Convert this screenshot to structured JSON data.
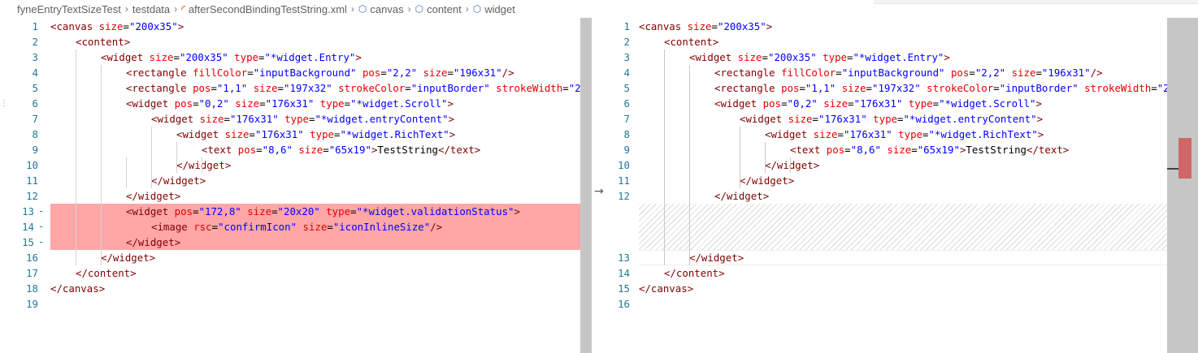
{
  "breadcrumb": {
    "items": [
      "fyneEntryTextSizeTest",
      "testdata",
      "afterSecondBindingTestString.xml",
      "canvas",
      "content",
      "widget"
    ],
    "separator": ">"
  },
  "icons": {
    "rss": "rss-icon",
    "xml_node": "cube-icon",
    "compare_arrow": "arrow-right-icon"
  },
  "colors": {
    "removed_highlight": "#ffa6a6",
    "line_number": "#237893",
    "tag": "#800000",
    "attribute": "#e50000",
    "value": "#0000ff"
  },
  "left_lines": [
    {
      "num": "1",
      "code": "<canvas size=\"200x35\">"
    },
    {
      "num": "2",
      "code": "<content>"
    },
    {
      "num": "3",
      "code": "<widget size=\"200x35\" type=\"*widget.Entry\">"
    },
    {
      "num": "4",
      "code": "<rectangle fillColor=\"inputBackground\" pos=\"2,2\" size=\"196x31\"/>"
    },
    {
      "num": "5",
      "code": "<rectangle pos=\"1,1\" size=\"197x32\" strokeColor=\"inputBorder\" strokeWidth=\"2"
    },
    {
      "num": "6",
      "code": "<widget pos=\"0,2\" size=\"176x31\" type=\"*widget.Scroll\">"
    },
    {
      "num": "7",
      "code": "<widget size=\"176x31\" type=\"*widget.entryContent\">"
    },
    {
      "num": "8",
      "code": "<widget size=\"176x31\" type=\"*widget.RichText\">"
    },
    {
      "num": "9",
      "code": "<text pos=\"8,6\" size=\"65x19\">TestString</text>"
    },
    {
      "num": "10",
      "code": "</widget>"
    },
    {
      "num": "11",
      "code": "</widget>"
    },
    {
      "num": "12",
      "code": "</widget>"
    },
    {
      "num": "13",
      "code": "<widget pos=\"172,8\" size=\"20x20\" type=\"*widget.validationStatus\">",
      "removed": true
    },
    {
      "num": "14",
      "code": "<image rsc=\"confirmIcon\" size=\"iconInlineSize\"/>",
      "removed": true
    },
    {
      "num": "15",
      "code": "</widget>",
      "removed": true
    },
    {
      "num": "16",
      "code": "</widget>"
    },
    {
      "num": "17",
      "code": "</content>"
    },
    {
      "num": "18",
      "code": "</canvas>"
    },
    {
      "num": "19",
      "code": ""
    }
  ],
  "right_lines": [
    {
      "num": "1",
      "code": "<canvas size=\"200x35\">"
    },
    {
      "num": "2",
      "code": "<content>"
    },
    {
      "num": "3",
      "code": "<widget size=\"200x35\" type=\"*widget.Entry\">"
    },
    {
      "num": "4",
      "code": "<rectangle fillColor=\"inputBackground\" pos=\"2,2\" size=\"196x31\"/>"
    },
    {
      "num": "5",
      "code": "<rectangle pos=\"1,1\" size=\"197x32\" strokeColor=\"inputBorder\" strokeWidth=\"2"
    },
    {
      "num": "6",
      "code": "<widget pos=\"0,2\" size=\"176x31\" type=\"*widget.Scroll\">"
    },
    {
      "num": "7",
      "code": "<widget size=\"176x31\" type=\"*widget.entryContent\">"
    },
    {
      "num": "8",
      "code": "<widget size=\"176x31\" type=\"*widget.RichText\">"
    },
    {
      "num": "9",
      "code": "<text pos=\"8,6\" size=\"65x19\">TestString</text>"
    },
    {
      "num": "10",
      "code": "</widget>"
    },
    {
      "num": "11",
      "code": "</widget>"
    },
    {
      "num": "12",
      "code": "</widget>"
    },
    {
      "num": "13",
      "code": "</widget>"
    },
    {
      "num": "14",
      "code": "</content>"
    },
    {
      "num": "15",
      "code": "</canvas>"
    },
    {
      "num": "16",
      "code": ""
    }
  ],
  "removed_marker": "-"
}
